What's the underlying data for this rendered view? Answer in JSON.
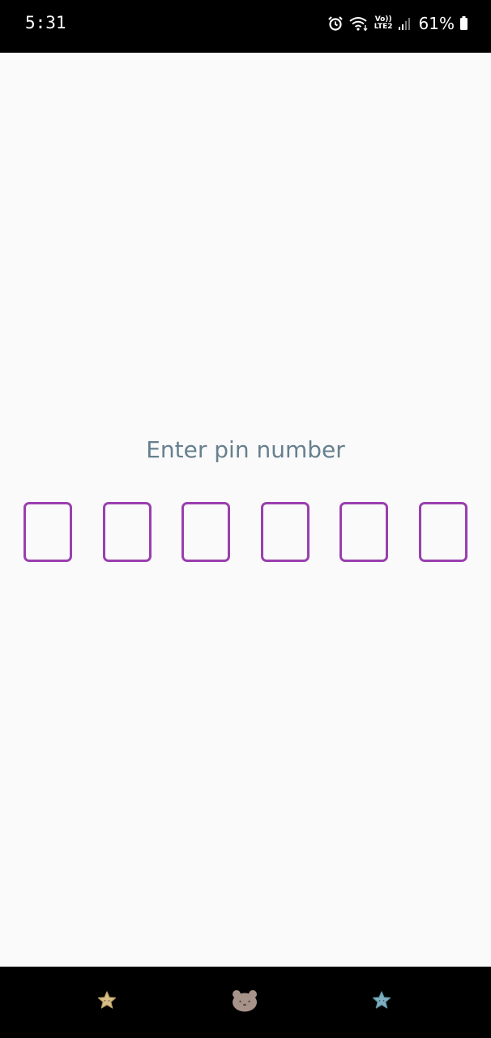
{
  "status_bar": {
    "time": "5:31",
    "net_top": "Vo))",
    "net_bottom": "LTE2",
    "battery": "61%",
    "icons": [
      "alarm-icon",
      "wifi-icon",
      "volte-icon",
      "signal-icon",
      "battery-icon"
    ]
  },
  "pin_screen": {
    "prompt": "Enter pin number",
    "digits": [
      "",
      "",
      "",
      "",
      "",
      ""
    ],
    "border_color": "#9a3fb0",
    "prompt_color": "#66808e"
  },
  "nav_bar": {
    "buttons": [
      {
        "name": "star-left-icon",
        "color": "#d8c08a"
      },
      {
        "name": "bear-face-icon",
        "color": "#a8938a"
      },
      {
        "name": "star-right-icon",
        "color": "#7fb0c0"
      }
    ]
  }
}
